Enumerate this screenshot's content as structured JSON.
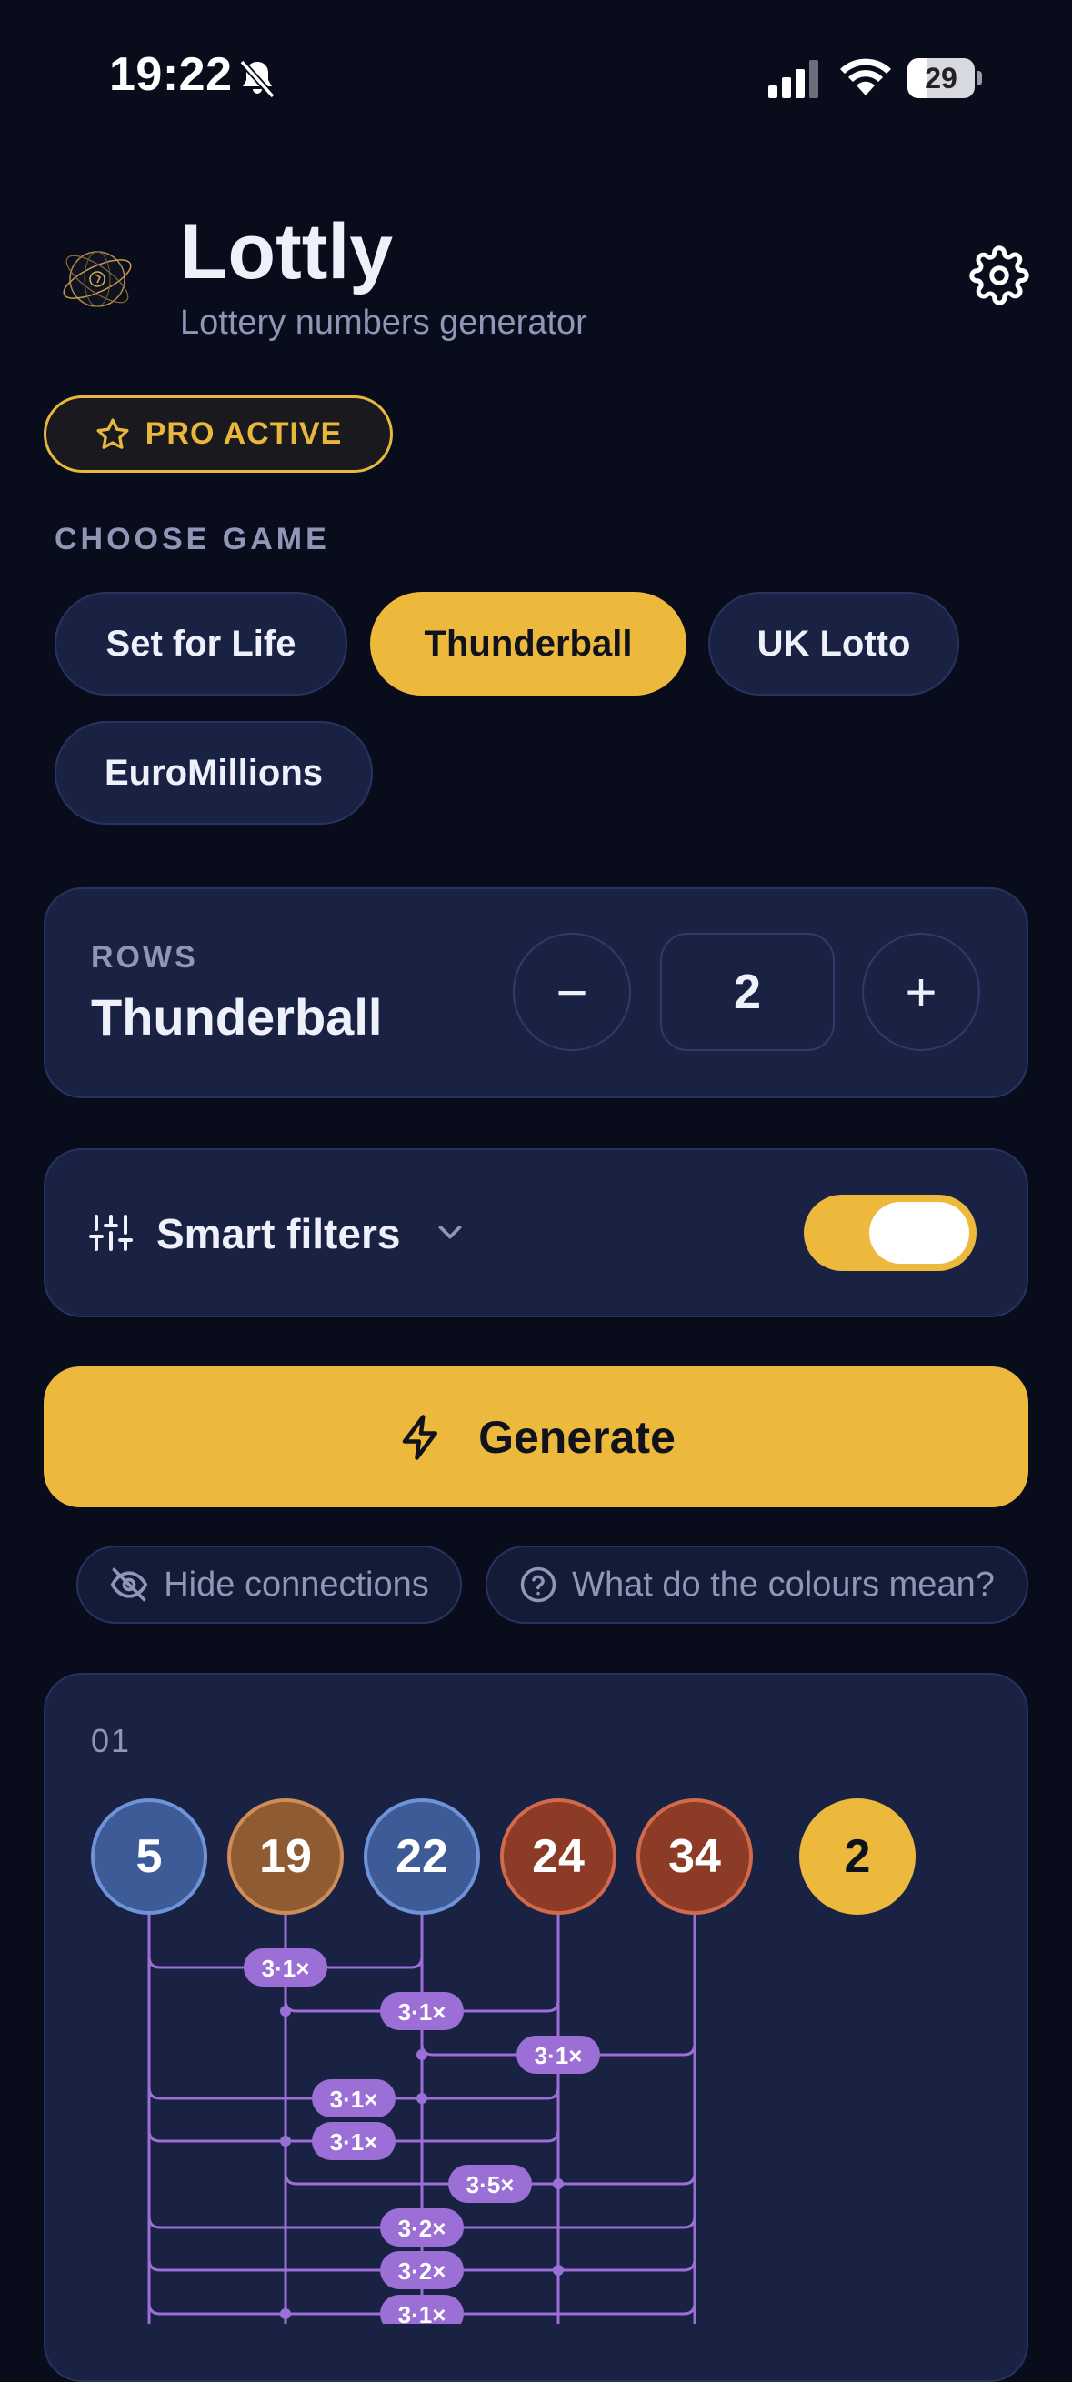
{
  "status_bar": {
    "time": "19:22",
    "battery": "29"
  },
  "header": {
    "title": "Lottly",
    "subtitle": "Lottery numbers generator"
  },
  "pro_badge": "PRO ACTIVE",
  "choose_game": {
    "label": "CHOOSE GAME",
    "games": [
      "Set for Life",
      "Thunderball",
      "UK Lotto",
      "EuroMillions"
    ],
    "selected": "Thunderball"
  },
  "rows_card": {
    "label": "ROWS",
    "game": "Thunderball",
    "count": "2",
    "minus": "−",
    "plus": "+"
  },
  "filters": {
    "label": "Smart filters",
    "enabled": true
  },
  "generate": {
    "label": "Generate"
  },
  "links": {
    "hide_connections": "Hide connections",
    "colours_help": "What do the colours mean?"
  },
  "result_row": {
    "index": "01",
    "main_numbers": [
      {
        "value": "5",
        "color": "blue"
      },
      {
        "value": "19",
        "color": "bronze"
      },
      {
        "value": "22",
        "color": "blue"
      },
      {
        "value": "24",
        "color": "red"
      },
      {
        "value": "34",
        "color": "red"
      }
    ],
    "bonus_number": "2",
    "connection_labels": [
      "3·1×",
      "3·1×",
      "3·1×",
      "3·1×",
      "3·1×",
      "3·5×",
      "3·2×",
      "3·2×",
      "3·1×"
    ]
  },
  "colors": {
    "accent": "#ecb93d",
    "card": "#1a2244",
    "background": "#090d1b",
    "connection": "#9b6fd6"
  }
}
